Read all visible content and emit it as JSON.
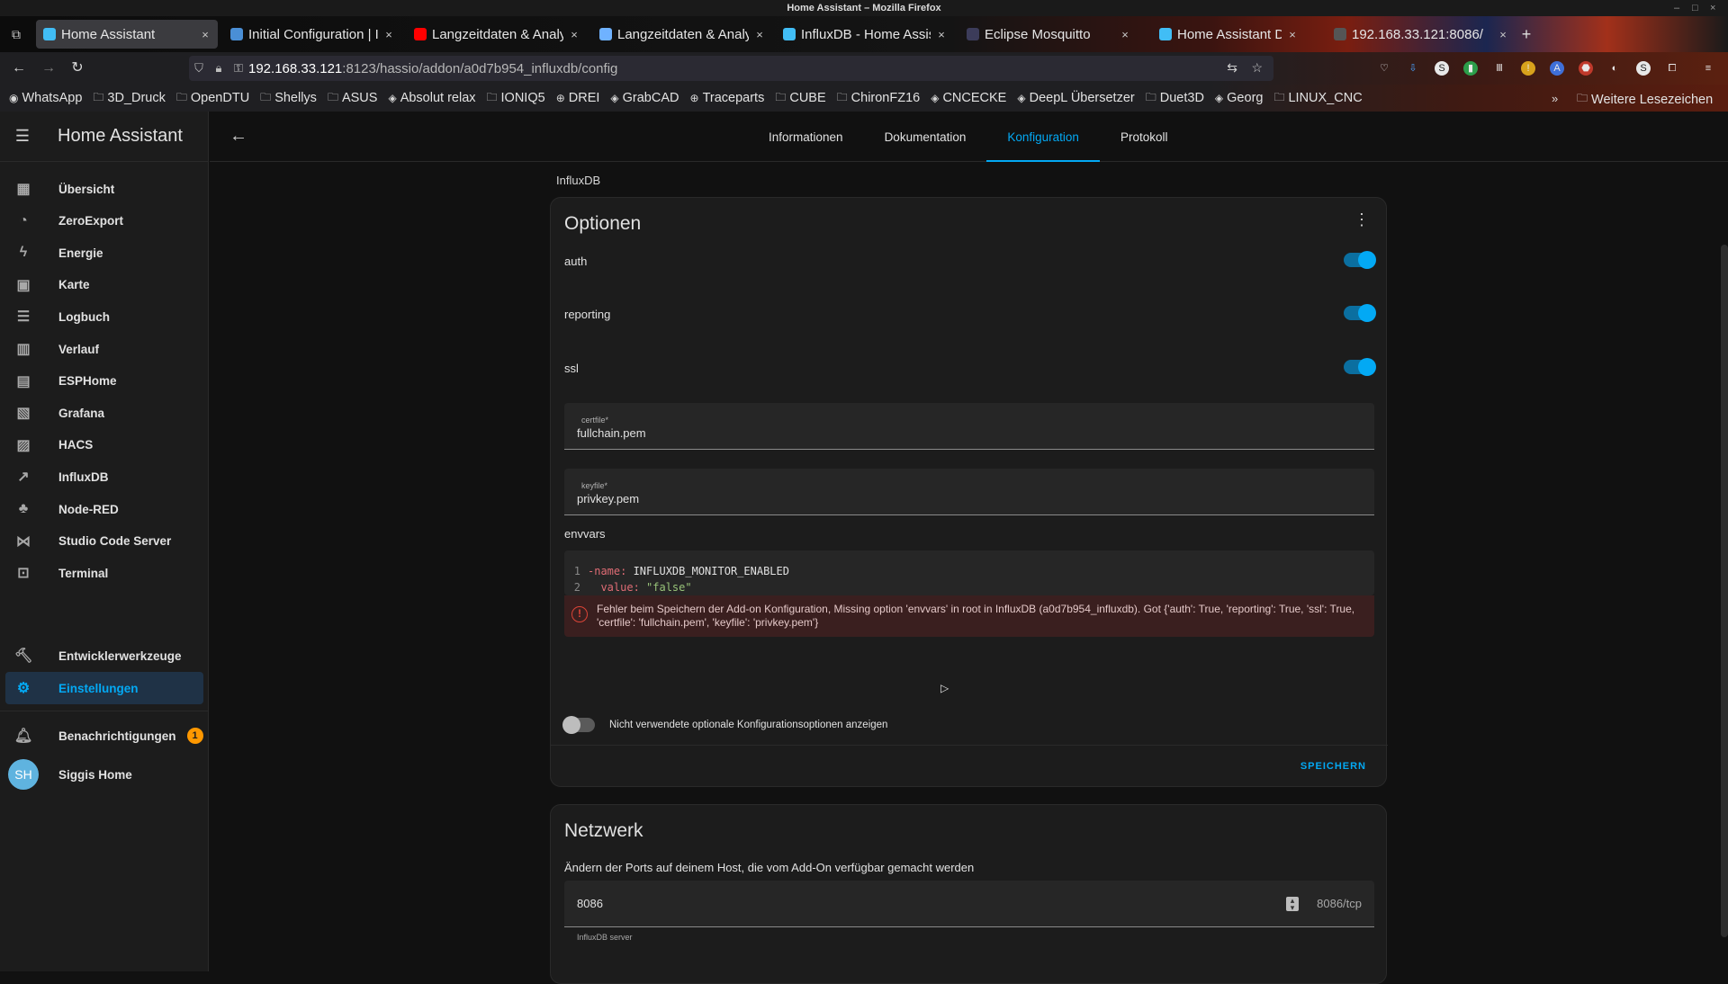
{
  "window": {
    "title": "Home Assistant – Mozilla Firefox"
  },
  "browser": {
    "tabs": [
      {
        "label": "Home Assistant",
        "active": true,
        "color": "#41bdf5"
      },
      {
        "label": "Initial Configuration | I",
        "active": false,
        "color": "#4a8fd6"
      },
      {
        "label": "Langzeitdaten & Analy",
        "active": false,
        "color": "#ff0000"
      },
      {
        "label": "Langzeitdaten & Analy",
        "active": false,
        "color": "#6fb2ff"
      },
      {
        "label": "InfluxDB - Home Assis",
        "active": false,
        "color": "#41bdf5"
      },
      {
        "label": "Eclipse Mosquitto",
        "active": false,
        "color": "#3c3c5a"
      },
      {
        "label": "Home Assistant Dash",
        "active": false,
        "color": "#41bdf5"
      },
      {
        "label": "192.168.33.121:8086/",
        "active": false,
        "color": "#555555"
      }
    ],
    "url_host": "192.168.33.121",
    "url_rest": ":8123/hassio/addon/a0d7b954_influxdb/config",
    "bookmarks": [
      {
        "label": "WhatsApp",
        "icon": "whatsapp-icon"
      },
      {
        "label": "3D_Druck",
        "icon": "folder-icon"
      },
      {
        "label": "OpenDTU",
        "icon": "folder-icon"
      },
      {
        "label": "Shellys",
        "icon": "folder-icon"
      },
      {
        "label": "ASUS",
        "icon": "folder-icon"
      },
      {
        "label": "Absolut relax",
        "icon": "site-icon"
      },
      {
        "label": "IONIQ5",
        "icon": "folder-icon"
      },
      {
        "label": "DREI",
        "icon": "globe-icon"
      },
      {
        "label": "GrabCAD",
        "icon": "site-icon"
      },
      {
        "label": "Traceparts",
        "icon": "globe-icon"
      },
      {
        "label": "CUBE",
        "icon": "folder-icon"
      },
      {
        "label": "ChironFZ16",
        "icon": "folder-icon"
      },
      {
        "label": "CNCECKE",
        "icon": "site-icon"
      },
      {
        "label": "DeepL Übersetzer",
        "icon": "site-icon"
      },
      {
        "label": "Duet3D",
        "icon": "folder-icon"
      },
      {
        "label": "Georg",
        "icon": "site-icon"
      },
      {
        "label": "LINUX_CNC",
        "icon": "folder-icon"
      }
    ],
    "bookmarks_more": "Weitere Lesezeichen"
  },
  "sidebar": {
    "title": "Home Assistant",
    "items": [
      {
        "label": "Übersicht",
        "icon": "dashboard-icon"
      },
      {
        "label": "ZeroExport",
        "icon": "gauge-icon"
      },
      {
        "label": "Energie",
        "icon": "lightning-icon"
      },
      {
        "label": "Karte",
        "icon": "map-icon"
      },
      {
        "label": "Logbuch",
        "icon": "list-icon"
      },
      {
        "label": "Verlauf",
        "icon": "chart-icon"
      },
      {
        "label": "ESPHome",
        "icon": "chip-icon"
      },
      {
        "label": "Grafana",
        "icon": "grafana-icon"
      },
      {
        "label": "HACS",
        "icon": "hacs-icon"
      },
      {
        "label": "InfluxDB",
        "icon": "chart-line-icon"
      },
      {
        "label": "Node-RED",
        "icon": "sitemap-icon"
      },
      {
        "label": "Studio Code Server",
        "icon": "vscode-icon"
      },
      {
        "label": "Terminal",
        "icon": "console-icon"
      }
    ],
    "dev_tools": "Entwicklerwerkzeuge",
    "settings": "Einstellungen",
    "notifications": "Benachrichtigungen",
    "notifications_count": "1",
    "user_initials": "SH",
    "user_name": "Siggis Home",
    "accent": "#03a9f4"
  },
  "main": {
    "tabs": [
      "Informationen",
      "Dokumentation",
      "Konfiguration",
      "Protokoll"
    ],
    "active_tab": "Konfiguration",
    "breadcrumb": "InfluxDB",
    "options": {
      "title": "Optionen",
      "toggles": [
        {
          "label": "auth",
          "on": true
        },
        {
          "label": "reporting",
          "on": true
        },
        {
          "label": "ssl",
          "on": true
        }
      ],
      "certfile_label": "certfile*",
      "certfile_value": "fullchain.pem",
      "keyfile_label": "keyfile*",
      "keyfile_value": "privkey.pem",
      "envvars_label": "envvars",
      "code_ln1": "1",
      "code_ln2": "2",
      "code_l1_key": "-name:",
      "code_l1_val": " INFLUXDB_MONITOR_ENABLED",
      "code_l2_key": "  value:",
      "code_l2_val": " \"false\"",
      "error_text": "Fehler beim Speichern der Add-on Konfiguration, Missing option 'envvars' in root in InfluxDB (a0d7b954_influxdb). Got {'auth': True, 'reporting': True, 'ssl': True, 'certfile': 'fullchain.pem', 'keyfile': 'privkey.pem'}",
      "show_unused_label": "Nicht verwendete optionale Konfigurationsoptionen anzeigen",
      "save_label": "SPEICHERN"
    },
    "network": {
      "title": "Netzwerk",
      "description": "Ändern der Ports auf deinem Host, die vom Add-On verfügbar gemacht werden",
      "port_value": "8086",
      "port_suffix": "8086/tcp",
      "port_hint": "InfluxDB server"
    }
  }
}
